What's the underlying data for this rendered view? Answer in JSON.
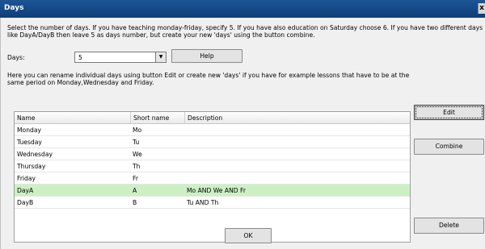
{
  "window": {
    "title": "Days",
    "close_label": "x"
  },
  "intro": {
    "line1": "Select the number of days. If you have teaching monday-friday, specify 5. If you have also education on Saturday choose 6. If you have two different days",
    "line2": "like DayA/DayB then leave 5 as days number, but create your new 'days' using the button combine."
  },
  "days": {
    "label": "Days:",
    "value": "5",
    "arrow": "▼",
    "help_label": "Help"
  },
  "info": {
    "line1": "Here you can rename individual days using button Edit or create new 'days' if you have for example lessons that have to be at the",
    "line2": "same period on Monday,Wednesday and Friday."
  },
  "table": {
    "columns": [
      "Name",
      "Short name",
      "Description"
    ],
    "rows": [
      {
        "name": "Monday",
        "short": "Mo",
        "desc": ""
      },
      {
        "name": "Tuesday",
        "short": "Tu",
        "desc": ""
      },
      {
        "name": "Wednesday",
        "short": "We",
        "desc": ""
      },
      {
        "name": "Thursday",
        "short": "Th",
        "desc": ""
      },
      {
        "name": "Friday",
        "short": "Fr",
        "desc": ""
      },
      {
        "name": "DayA",
        "short": "A",
        "desc": "Mo AND We AND Fr"
      },
      {
        "name": "DayB",
        "short": "B",
        "desc": "Tu AND Th"
      }
    ],
    "selected_row": "DayA",
    "selected_color": "#ccf0c4"
  },
  "buttons": {
    "edit": "Edit",
    "combine": "Combine",
    "delete": "Delete",
    "ok": "OK"
  }
}
